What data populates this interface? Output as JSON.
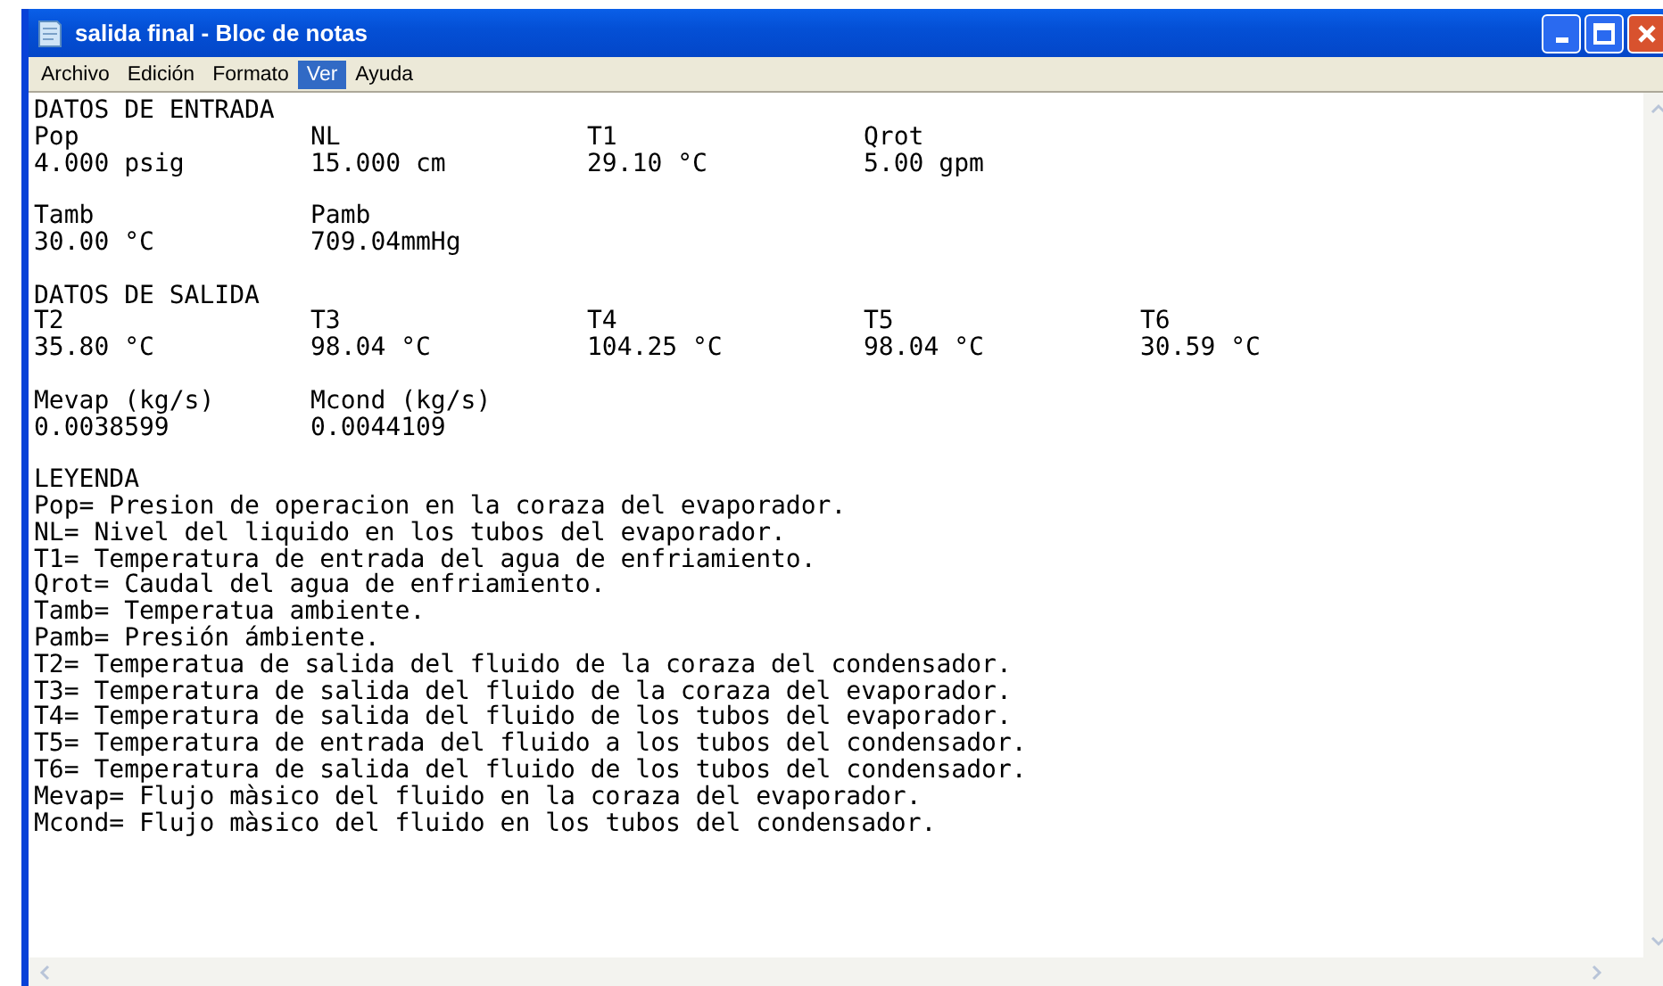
{
  "window": {
    "title": "salida final - Bloc de notas"
  },
  "menu": [
    {
      "label": "Archivo",
      "selected": false
    },
    {
      "label": "Edición",
      "selected": false
    },
    {
      "label": "Formato",
      "selected": false
    },
    {
      "label": "Ver",
      "selected": true
    },
    {
      "label": "Ayuda",
      "selected": false
    }
  ],
  "document": {
    "sections": [
      {
        "heading": "DATOS DE ENTRADA",
        "groups": [
          [
            {
              "label": "Pop",
              "value": "4.000 psig"
            },
            {
              "label": "NL",
              "value": "15.000 cm"
            },
            {
              "label": "T1",
              "value": "29.10 °C"
            },
            {
              "label": "Qrot",
              "value": "5.00 gpm"
            }
          ],
          [
            {
              "label": "Tamb",
              "value": "30.00 °C"
            },
            {
              "label": "Pamb",
              "value": "709.04mmHg"
            }
          ]
        ]
      },
      {
        "heading": "DATOS DE SALIDA",
        "groups": [
          [
            {
              "label": "T2",
              "value": "35.80 °C"
            },
            {
              "label": "T3",
              "value": "98.04 °C"
            },
            {
              "label": "T4",
              "value": "104.25 °C"
            },
            {
              "label": "T5",
              "value": "98.04 °C"
            },
            {
              "label": "T6",
              "value": "30.59 °C"
            }
          ],
          [
            {
              "label": "Mevap (kg/s)",
              "value": "0.0038599"
            },
            {
              "label": "Mcond (kg/s)",
              "value": "0.0044109"
            }
          ]
        ]
      }
    ],
    "legend": {
      "heading": "LEYENDA",
      "lines": [
        "Pop= Presion de operacion en la coraza del evaporador.",
        "NL= Nivel del liquido en los tubos del evaporador.",
        "T1= Temperatura de entrada del agua de enfriamiento.",
        "Qrot= Caudal del agua de enfriamiento.",
        "Tamb= Temperatua ambiente.",
        "Pamb= Presión ámbiente.",
        "T2= Temperatua de salida del fluido de la coraza del condensador.",
        "T3= Temperatura de salida del fluido de la coraza del evaporador.",
        "T4= Temperatura de salida del fluido de los tubos del evaporador.",
        "T5= Temperatura de entrada del fluido a los tubos del condensador.",
        "T6= Temperatura de salida del fluido de los tubos del condensador.",
        "Mevap= Flujo màsico del fluido en la coraza del evaporador.",
        "Mcond= Flujo màsico del fluido en los tubos del condensador."
      ]
    }
  }
}
